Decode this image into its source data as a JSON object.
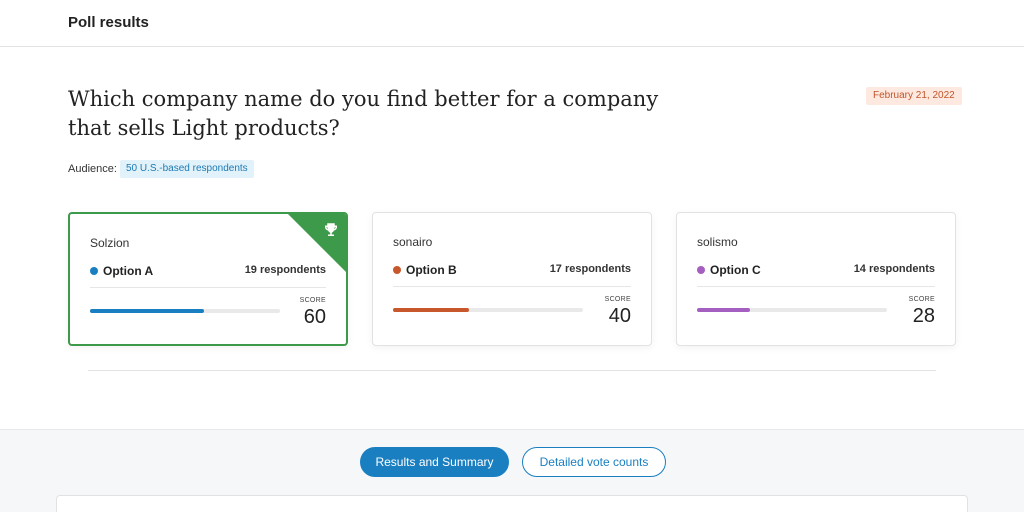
{
  "header": {
    "title": "Poll results"
  },
  "poll": {
    "question": "Which company name do you find better for a company that sells Light products?",
    "date": "February 21, 2022",
    "audience_label": "Audience:",
    "audience_value": "50 U.S.-based respondents"
  },
  "options": [
    {
      "name": "Solzion",
      "label": "Option A",
      "respondents": "19 respondents",
      "score_label": "SCORE",
      "score": "60",
      "score_fraction": 0.6,
      "color": "#1a7fc1",
      "winner": true
    },
    {
      "name": "sonairo",
      "label": "Option B",
      "respondents": "17 respondents",
      "score_label": "SCORE",
      "score": "40",
      "score_fraction": 0.4,
      "color": "#c8572b",
      "winner": false
    },
    {
      "name": "solismo",
      "label": "Option C",
      "respondents": "14 respondents",
      "score_label": "SCORE",
      "score": "28",
      "score_fraction": 0.28,
      "color": "#a55fc0",
      "winner": false
    }
  ],
  "tabs": [
    {
      "label": "Results and Summary",
      "active": true
    },
    {
      "label": "Detailed vote counts",
      "active": false
    }
  ],
  "icons": {
    "winner": "trophy-icon"
  },
  "colors": {
    "winner_border": "#3e9a4b",
    "primary": "#1a7fc1"
  }
}
